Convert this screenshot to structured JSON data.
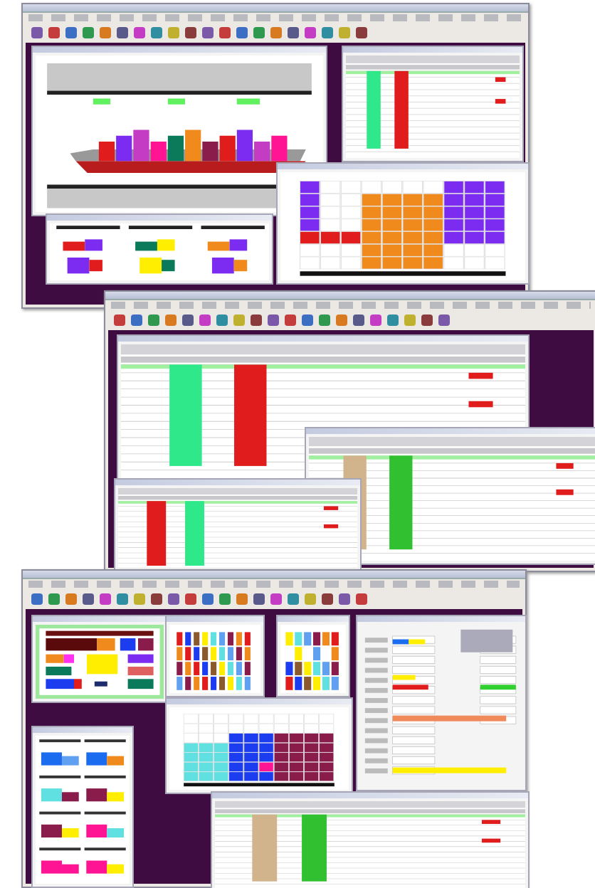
{
  "screens": [
    {
      "windows": [
        {
          "kind": "ship"
        },
        {
          "kind": "grid"
        },
        {
          "kind": "bay"
        },
        {
          "kind": "stacks"
        }
      ]
    },
    {
      "windows": [
        {
          "kind": "grid"
        },
        {
          "kind": "grid"
        },
        {
          "kind": "grid"
        }
      ]
    },
    {
      "windows": [
        {
          "kind": "blocks"
        },
        {
          "kind": "columns"
        },
        {
          "kind": "columns"
        },
        {
          "kind": "form"
        },
        {
          "kind": "bay"
        },
        {
          "kind": "charts"
        },
        {
          "kind": "grid"
        }
      ]
    }
  ]
}
